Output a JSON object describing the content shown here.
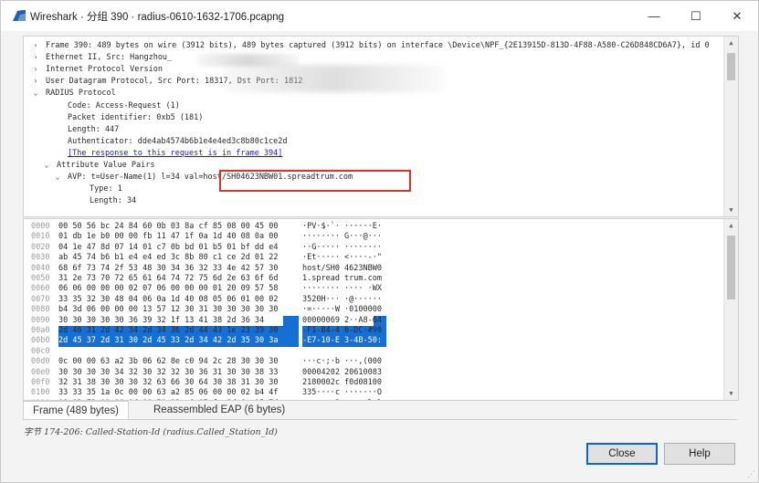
{
  "window": {
    "title": "Wireshark · 分组 390 · radius-0610-1632-1706.pcapng"
  },
  "titlebar": {
    "minimize": "—",
    "maximize": "☐",
    "close": "✕"
  },
  "tree": [
    {
      "arrow": ">",
      "indent": 0,
      "text": "Frame 390: 489 bytes on wire (3912 bits), 489 bytes captured (3912 bits) on interface \\Device\\NPF_{2E13915D-813D-4F88-A580-C26D848CD6A7}, id 0"
    },
    {
      "arrow": ">",
      "indent": 0,
      "text": "Ethernet II, Src: Hangzhou_"
    },
    {
      "arrow": ">",
      "indent": 0,
      "text": "Internet Protocol Version"
    },
    {
      "arrow": ">",
      "indent": 0,
      "text": "User Datagram Protocol, Src Port: 18317, Dst Port: 1812"
    },
    {
      "arrow": "v",
      "indent": 0,
      "text": "RADIUS Protocol"
    },
    {
      "arrow": "",
      "indent": 2,
      "text": "Code: Access-Request (1)"
    },
    {
      "arrow": "",
      "indent": 2,
      "text": "Packet identifier: 0xb5 (181)"
    },
    {
      "arrow": "",
      "indent": 2,
      "text": "Length: 447"
    },
    {
      "arrow": "",
      "indent": 2,
      "text": "Authenticator: dde4ab4574b6b1e4e4ed3c8b80c1ce2d"
    },
    {
      "arrow": "",
      "indent": 2,
      "text": "[The response to this request is in frame 394]",
      "link": true
    },
    {
      "arrow": "v",
      "indent": 1,
      "text": "Attribute Value Pairs"
    },
    {
      "arrow": "v",
      "indent": 2,
      "text": "AVP: t=User-Name(1) l=34  val=host/SH04623NBW01.spreadtrum.com"
    },
    {
      "arrow": "",
      "indent": 4,
      "text": "Type: 1"
    },
    {
      "arrow": "",
      "indent": 4,
      "text": "Length: 34"
    }
  ],
  "hex_rows": [
    {
      "offset": "0000",
      "hex": "00 50 56 bc 24 84 60 0b  03 8a cf 85 08 00 45 00",
      "ascii": "·PV·$·`· ······E·"
    },
    {
      "offset": "0010",
      "hex": "01 db 1e b0 00 00 fb 11  47 1f 0a 1d 40 08 0a 00",
      "ascii": "········ G···@···"
    },
    {
      "offset": "0020",
      "hex": "04 1e 47 8d 07 14 01 c7  0b bd 01 b5 01 bf dd e4",
      "ascii": "··G····· ········"
    },
    {
      "offset": "0030",
      "hex": "ab 45 74 b6 b1 e4 e4 ed  3c 8b 80 c1 ce 2d 01 22",
      "ascii": "·Et····· <····-·\""
    },
    {
      "offset": "0040",
      "hex": "68 6f 73 74 2f 53 48 30  34 36 32 33 4e 42 57 30",
      "ascii": "host/SH0 4623NBW0"
    },
    {
      "offset": "0050",
      "hex": "31 2e 73 70 72 65 61 64  74 72 75 6d 2e 63 6f 6d",
      "ascii": "1.spread trum.com"
    },
    {
      "offset": "0060",
      "hex": "06 06 00 00 00 02 07 06  00 00 00 01 20 09 57 58",
      "ascii": "········ ···· ·WX"
    },
    {
      "offset": "0070",
      "hex": "33 35 32 30 48 04 06 0a  1d 40 08 05 06 01 00 02",
      "ascii": "3520H··· ·@······"
    },
    {
      "offset": "0080",
      "hex": "b4 3d 06 00 00 00 13 57  12 30 31 30 30 30 30 30",
      "ascii": "·=·····W ·0100000"
    },
    {
      "offset": "0090",
      "hex": "30 30 30 30 30 36 39 32  1f 13 41 38 2d 36 34",
      "ascii": "00000069 2··A8-64"
    },
    {
      "offset": "00a0",
      "hex": "2d 46 31 2d 42 34 2d 34  36 2d 44 43 1e 23 39 30",
      "ascii": "-F1-B4-4 6-DC·#90"
    },
    {
      "offset": "00b0",
      "hex": "2d 45 37 2d 31 30 2d 45  33 2d 34 42 2d 35 30 3a",
      "ascii": "-E7-10-E 3-4B-50:"
    },
    {
      "offset": "00c0",
      "hex": "55 4e 49 53 4f 43 5f 77  69 72 65 6c 65 73 73 1a",
      "ascii": "UNISOC_w ireless·"
    },
    {
      "offset": "00d0",
      "hex": "0c 00 00 63 a2 3b 06 62  8e c0 94 2c 28 30 30 30",
      "ascii": "···c·;·b ···,(000"
    },
    {
      "offset": "00e0",
      "hex": "30 30 30 30 34 32 30 32  32 30 36 31 30 30 38 33",
      "ascii": "00004202 20610083"
    },
    {
      "offset": "00f0",
      "hex": "32 31 38 30 30 30 32 63  66 30 64 30 38 31 30 30",
      "ascii": "2180002c f0d08100"
    },
    {
      "offset": "0100",
      "hex": "33 33 35 1a 0c 00 00 63  a2 85 06 00 00 02 b4 4f",
      "ascii": "335····c ·······O"
    },
    {
      "offset": "0110",
      "hex": "08 02 72 00 06 0d 00 50  12 e6 67 fa 6d 6c 15 7d",
      "ascii": "··r····P ··g·ml·}"
    }
  ],
  "tabs": {
    "frame": "Frame (489 bytes)",
    "reassembled": "Reassembled EAP (6 bytes)"
  },
  "status": "字节 174-206: Called-Station-Id (radius.Called_Station_Id)",
  "buttons": {
    "close": "Close",
    "help": "Help"
  },
  "colors": {
    "accent": "#1570d6",
    "highlight_box": "#e0302a",
    "link": "#1a1ad6"
  }
}
